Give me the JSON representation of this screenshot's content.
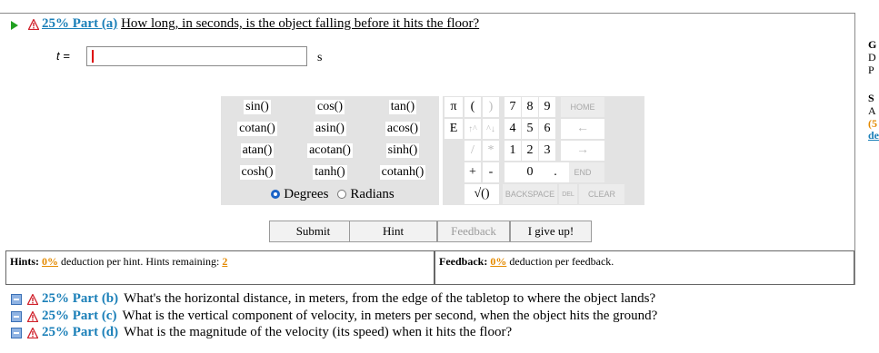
{
  "part_a": {
    "percent": "25% Part (a)",
    "question": "How long, in seconds, is the object falling before it hits the floor?",
    "var_label": "t =",
    "unit": "s",
    "answer_value": ""
  },
  "calculator": {
    "functions": [
      [
        "sin()",
        "cos()",
        "tan()"
      ],
      [
        "cotan()",
        "asin()",
        "acos()"
      ],
      [
        "atan()",
        "acotan()",
        "sinh()"
      ],
      [
        "cosh()",
        "tanh()",
        "cotanh()"
      ]
    ],
    "degrees": "Degrees",
    "radians": "Radians",
    "angle_mode": "Degrees",
    "keys": {
      "pi": "π",
      "lparen": "(",
      "rparen": ")",
      "e": "E",
      "up": "↑^",
      "down": "^↓",
      "div": "/",
      "mul": "*",
      "plus": "+",
      "minus": "-",
      "sqrt": "√()",
      "d7": "7",
      "d8": "8",
      "d9": "9",
      "d4": "4",
      "d5": "5",
      "d6": "6",
      "d1": "1",
      "d2": "2",
      "d3": "3",
      "d0": "0",
      "dot": ".",
      "home": "HOME",
      "back_arrow": "←",
      "fwd_arrow": "→",
      "end": "END",
      "backspace": "BACKSPACE",
      "del": "DEL",
      "clear": "CLEAR"
    }
  },
  "buttons": {
    "submit": "Submit",
    "hint": "Hint",
    "feedback": "Feedback",
    "give_up": "I give up!"
  },
  "hints": {
    "label": "Hints:",
    "percent": "0%",
    "text": "deduction per hint. Hints remaining:",
    "remaining": "2"
  },
  "feedback": {
    "label": "Feedback:",
    "percent": "0%",
    "text": "deduction per feedback."
  },
  "other_parts": [
    {
      "percent": "25% Part (b)",
      "question": "What's the horizontal distance, in meters, from the edge of the tabletop to where the object lands?"
    },
    {
      "percent": "25% Part (c)",
      "question": "What is the vertical component of velocity, in meters per second, when the object hits the ground?"
    },
    {
      "percent": "25% Part (d)",
      "question": "What is the magnitude of the velocity (its speed) when it hits the floor?"
    }
  ],
  "sidebar": {
    "line1": "G",
    "line2": "D",
    "line3": "P",
    "line4": "S",
    "line5": "A",
    "line6": "(5",
    "line7": "de"
  },
  "colors": {
    "accent_blue": "#1a7fb8",
    "orange": "#e48a00",
    "warning_red": "#d0202a",
    "play_green": "#22a022",
    "radio_blue": "#1b63c6"
  }
}
